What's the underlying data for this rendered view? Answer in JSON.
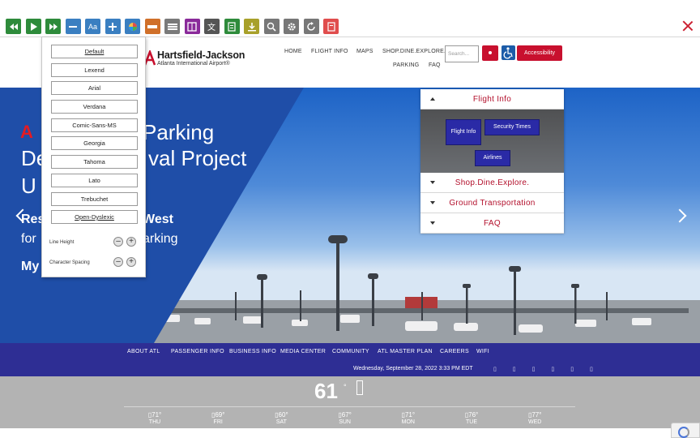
{
  "toolbar": {
    "buttons": [
      {
        "name": "rewind-icon",
        "color": "#2e8b3b"
      },
      {
        "name": "play-icon",
        "color": "#2e8b3b"
      },
      {
        "name": "fast-forward-icon",
        "color": "#2e8b3b"
      },
      {
        "name": "decrease-text-icon",
        "color": "#3a7fc1"
      },
      {
        "name": "font-icon",
        "color": "#3a7fc1",
        "glyph": "Aa"
      },
      {
        "name": "increase-text-icon",
        "color": "#3a7fc1"
      },
      {
        "name": "color-wheel-icon",
        "color": "#3a7fc1"
      },
      {
        "name": "ruler-icon",
        "color": "#d0702a"
      },
      {
        "name": "mask-icon",
        "color": "#7a7a7a"
      },
      {
        "name": "dictionary-icon",
        "color": "#8a2a9a"
      },
      {
        "name": "translate-icon",
        "color": "#555555"
      },
      {
        "name": "summary-icon",
        "color": "#2e8b3b"
      },
      {
        "name": "download-icon",
        "color": "#a8a02a"
      },
      {
        "name": "magnifier-icon",
        "color": "#777777"
      },
      {
        "name": "settings-icon",
        "color": "#777777"
      },
      {
        "name": "reset-icon",
        "color": "#777777"
      },
      {
        "name": "pdf-icon",
        "color": "#e04d4d"
      }
    ]
  },
  "font_panel": {
    "options": [
      "Default",
      "Lexend",
      "Arial",
      "Verdana",
      "Comic-Sans-MS",
      "Georgia",
      "Tahoma",
      "Lato",
      "Trebuchet",
      "Open-Dyslexic"
    ],
    "line_height_label": "Line Height",
    "char_spacing_label": "Character Spacing",
    "minus": "–",
    "plus": "+"
  },
  "header": {
    "logo_line1": "Hartsfield-Jackson",
    "logo_line2": "Atlanta International Airport®",
    "nav_row1": [
      "HOME",
      "FLIGHT INFO",
      "MAPS",
      "SHOP.DINE.EXPLORE."
    ],
    "nav_row2": [
      "PARKING",
      "FAQ"
    ],
    "search_placeholder": "Search...",
    "accessibility_label": "Accessibility"
  },
  "hero": {
    "line1": "Parking",
    "line2": "De            val Project",
    "line2_left": "De",
    "line2_right": "val Project",
    "line3": "U",
    "line4_left": "Res",
    "line4_right": "West",
    "line5_left": "for",
    "line5_right": "arking",
    "line6": "My",
    "atl_logo_text": "A"
  },
  "accordion": {
    "sections": [
      {
        "label": "Flight Info",
        "open": true
      },
      {
        "label": "Shop.Dine.Explore.",
        "open": false
      },
      {
        "label": "Ground Transportation",
        "open": false
      },
      {
        "label": "FAQ",
        "open": false
      }
    ],
    "flight_buttons": [
      "Flight Info",
      "Security Times",
      "Airlines"
    ]
  },
  "blue_nav": {
    "items": [
      "ABOUT ATL",
      "PASSENGER INFO",
      "BUSINESS INFO",
      "MEDIA CENTER",
      "COMMUNITY",
      "ATL MASTER PLAN",
      "CAREERS",
      "WIFI"
    ],
    "datetime": "Wednesday, September 28, 2022 3:33 PM EDT",
    "social_placeholders": "▯ ▯ ▯ ▯ ▯ ▯"
  },
  "weather": {
    "current_temp": "61",
    "degree": "°",
    "forecast": [
      {
        "temp": "▯71°",
        "day": "THU"
      },
      {
        "temp": "▯69°",
        "day": "FRI"
      },
      {
        "temp": "▯60°",
        "day": "SAT"
      },
      {
        "temp": "▯67°",
        "day": "SUN"
      },
      {
        "temp": "▯71°",
        "day": "MON"
      },
      {
        "temp": "▯76°",
        "day": "TUE"
      },
      {
        "temp": "▯77°",
        "day": "WED"
      }
    ]
  },
  "colors": {
    "brand_red": "#c8102e",
    "nav_blue": "#2e2e94",
    "hero_blue": "#1f4ea8",
    "weather_gray": "#b3b3b3"
  }
}
